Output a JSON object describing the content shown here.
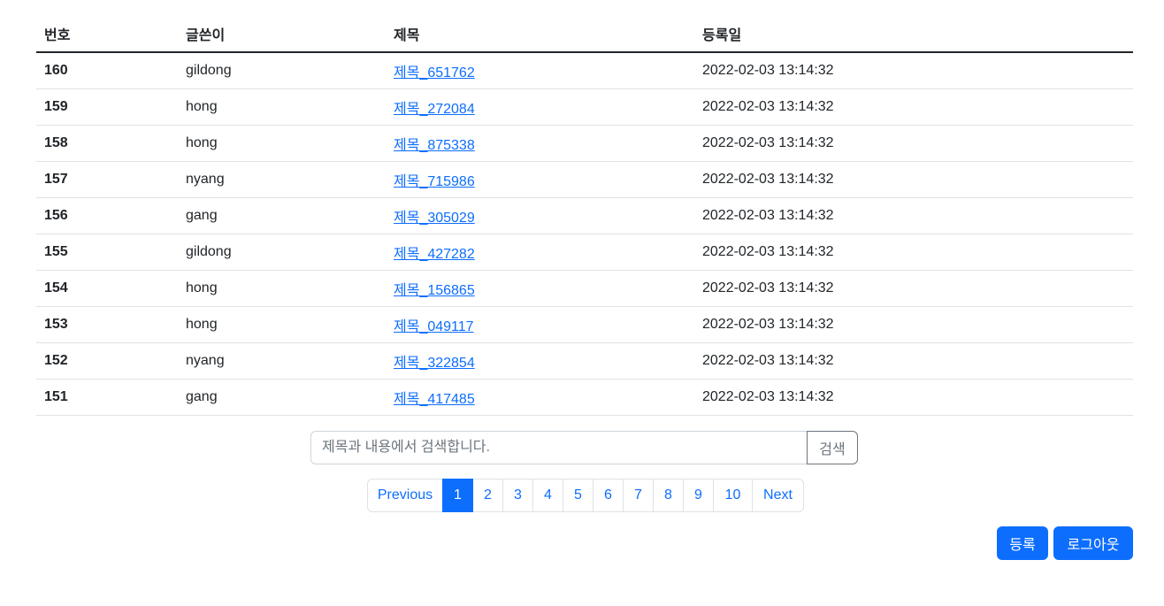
{
  "table": {
    "headers": {
      "num": "번호",
      "writer": "글쓴이",
      "title": "제목",
      "date": "등록일"
    },
    "rows": [
      {
        "num": "160",
        "writer": "gildong",
        "title": "제목_651762",
        "date": "2022-02-03 13:14:32"
      },
      {
        "num": "159",
        "writer": "hong",
        "title": "제목_272084",
        "date": "2022-02-03 13:14:32"
      },
      {
        "num": "158",
        "writer": "hong",
        "title": "제목_875338",
        "date": "2022-02-03 13:14:32"
      },
      {
        "num": "157",
        "writer": "nyang",
        "title": "제목_715986",
        "date": "2022-02-03 13:14:32"
      },
      {
        "num": "156",
        "writer": "gang",
        "title": "제목_305029",
        "date": "2022-02-03 13:14:32"
      },
      {
        "num": "155",
        "writer": "gildong",
        "title": "제목_427282",
        "date": "2022-02-03 13:14:32"
      },
      {
        "num": "154",
        "writer": "hong",
        "title": "제목_156865",
        "date": "2022-02-03 13:14:32"
      },
      {
        "num": "153",
        "writer": "hong",
        "title": "제목_049117",
        "date": "2022-02-03 13:14:32"
      },
      {
        "num": "152",
        "writer": "nyang",
        "title": "제목_322854",
        "date": "2022-02-03 13:14:32"
      },
      {
        "num": "151",
        "writer": "gang",
        "title": "제목_417485",
        "date": "2022-02-03 13:14:32"
      }
    ]
  },
  "search": {
    "placeholder": "제목과 내용에서 검색합니다.",
    "value": "",
    "button_label": "검색"
  },
  "pagination": {
    "previous_label": "Previous",
    "next_label": "Next",
    "pages": [
      "1",
      "2",
      "3",
      "4",
      "5",
      "6",
      "7",
      "8",
      "9",
      "10"
    ],
    "active_page": "1"
  },
  "actions": {
    "register_label": "등록",
    "logout_label": "로그아웃"
  },
  "colors": {
    "primary": "#0d6efd",
    "text": "#212529",
    "border": "#dee2e6",
    "muted": "#6c757d"
  }
}
